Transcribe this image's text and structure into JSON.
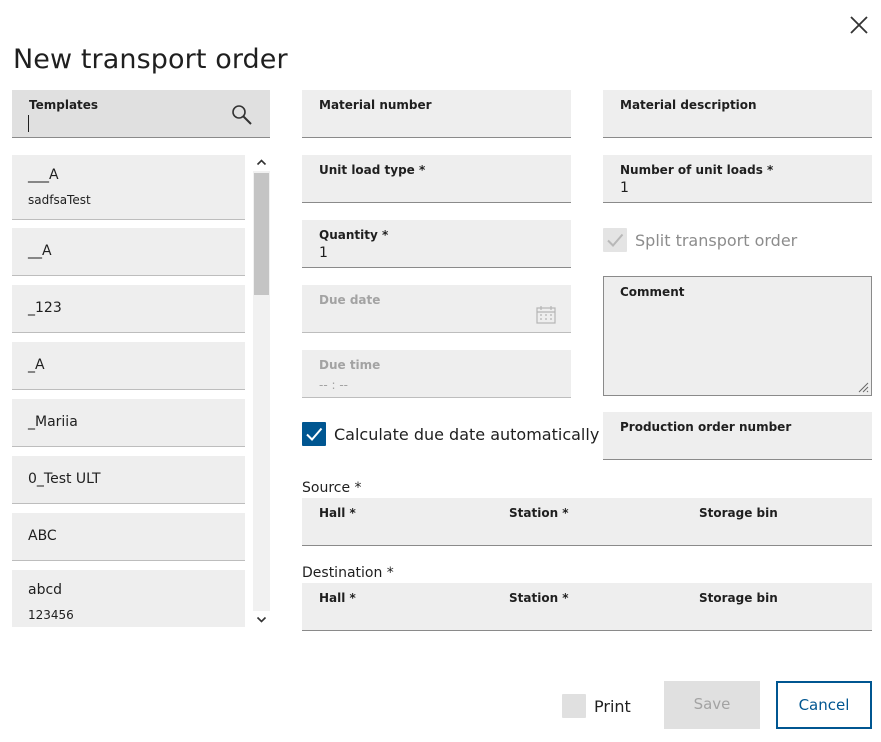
{
  "dialog": {
    "title": "New transport order",
    "close_icon": "close-icon"
  },
  "templates": {
    "label": "Templates",
    "search_value": "",
    "search_icon": "search-icon",
    "items": [
      {
        "name": "___A",
        "sub": "sadfsaTest"
      },
      {
        "name": "__A",
        "sub": ""
      },
      {
        "name": "_123",
        "sub": ""
      },
      {
        "name": "_A",
        "sub": ""
      },
      {
        "name": "_Mariia",
        "sub": ""
      },
      {
        "name": "0_Test ULT",
        "sub": ""
      },
      {
        "name": "ABC",
        "sub": ""
      },
      {
        "name": "abcd",
        "sub": "123456"
      }
    ]
  },
  "form": {
    "material_number": {
      "label": "Material number",
      "value": ""
    },
    "material_description": {
      "label": "Material description",
      "value": ""
    },
    "unit_load_type": {
      "label": "Unit load type *",
      "value": ""
    },
    "number_of_unit_loads": {
      "label": "Number of unit loads *",
      "value": "1"
    },
    "quantity": {
      "label": "Quantity *",
      "value": "1"
    },
    "split_transport_order": {
      "label": "Split transport order",
      "checked": true,
      "disabled": true
    },
    "due_date": {
      "label": "Due date",
      "value": "",
      "icon": "calendar-icon",
      "disabled": true
    },
    "due_time": {
      "label": "Due time",
      "value": "-- : --",
      "disabled": true
    },
    "comment": {
      "label": "Comment",
      "value": ""
    },
    "calculate_due_date": {
      "label": "Calculate due date automatically",
      "checked": true
    },
    "production_order_number": {
      "label": "Production order number",
      "value": ""
    },
    "source": {
      "label": "Source *",
      "hall": "Hall *",
      "station": "Station *",
      "storage_bin": "Storage bin"
    },
    "destination": {
      "label": "Destination *",
      "hall": "Hall *",
      "station": "Station *",
      "storage_bin": "Storage bin"
    }
  },
  "footer": {
    "print_label": "Print",
    "print_checked": false,
    "save_label": "Save",
    "cancel_label": "Cancel"
  },
  "colors": {
    "accent": "#005691",
    "field_bg": "#eeeeee",
    "disabled_text": "#a3a3a3"
  }
}
